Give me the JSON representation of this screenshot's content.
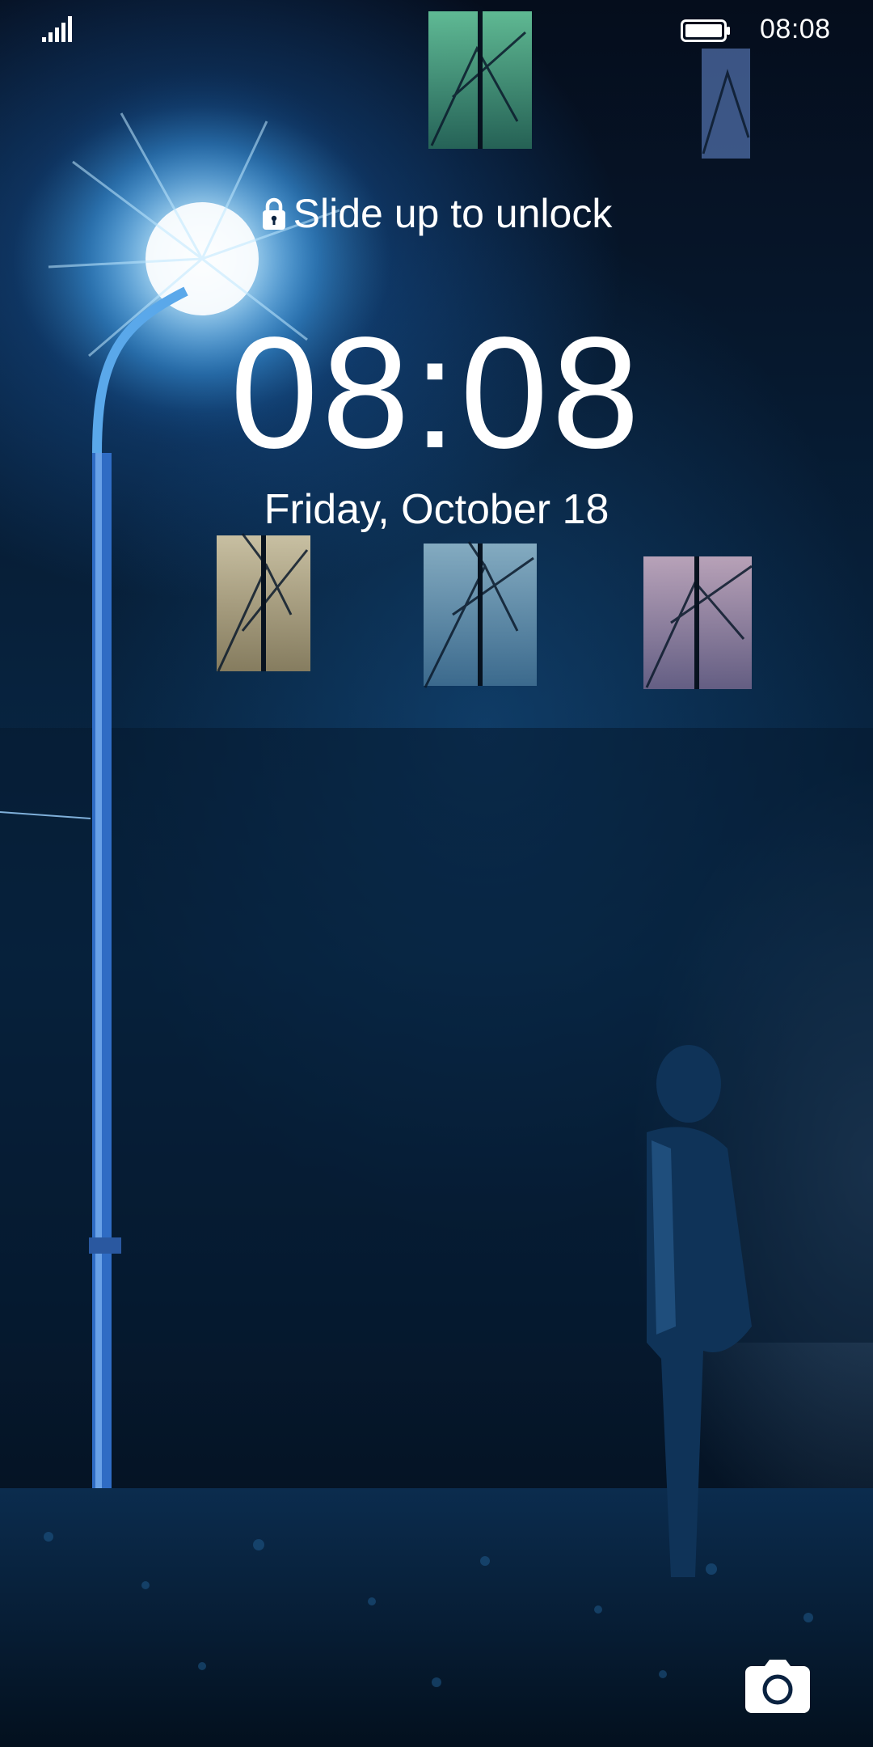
{
  "status_bar": {
    "signal_icon": "cellular-signal-icon",
    "battery_icon": "battery-full-icon",
    "time": "08:08"
  },
  "lock_screen": {
    "unlock_hint": "Slide up to unlock",
    "lock_icon": "lock-icon",
    "clock": "08:08",
    "date": "Friday, October 18"
  },
  "shortcuts": {
    "camera_icon": "camera-icon"
  },
  "colors": {
    "text": "#ffffff",
    "wallpaper_accent": "#3aa6ff"
  }
}
